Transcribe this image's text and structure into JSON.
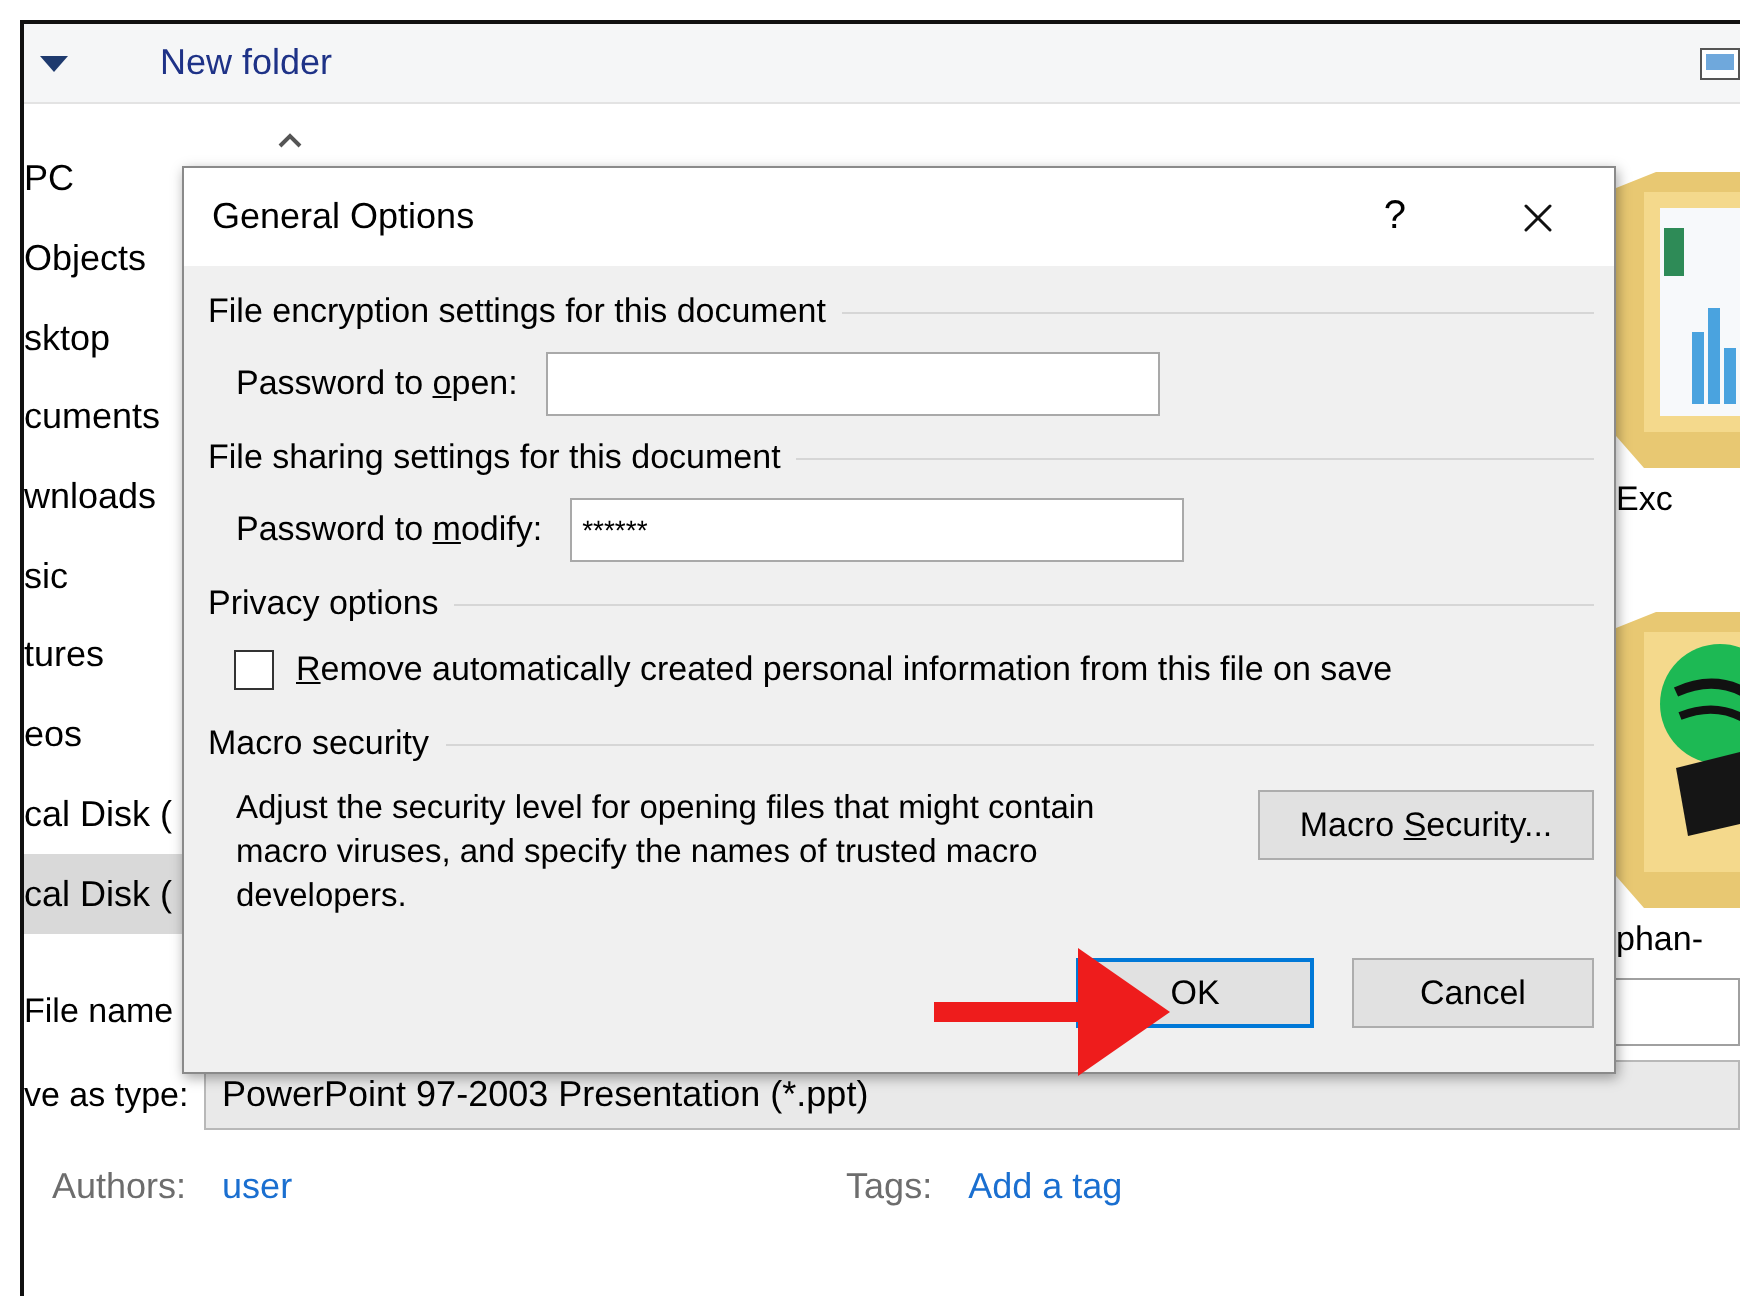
{
  "explorer": {
    "new_folder": "New folder",
    "nav_items": [
      {
        "label": "PC",
        "selected": false
      },
      {
        "label": "Objects",
        "selected": false
      },
      {
        "label": "sktop",
        "selected": false
      },
      {
        "label": "cuments",
        "selected": false
      },
      {
        "label": "wnloads",
        "selected": false
      },
      {
        "label": "sic",
        "selected": false
      },
      {
        "label": "tures",
        "selected": false
      },
      {
        "label": "eos",
        "selected": false
      },
      {
        "label": "cal Disk (",
        "selected": false
      },
      {
        "label": "cal Disk (",
        "selected": true
      }
    ],
    "files": [
      {
        "label": "Exc",
        "kind": "spreadsheet"
      },
      {
        "label": "phan-",
        "kind": "music"
      }
    ],
    "file_name": {
      "label": "File name"
    },
    "save_as_type": {
      "label": "ve as type:",
      "value": "PowerPoint 97-2003 Presentation (*.ppt)"
    },
    "authors": {
      "label": "Authors:",
      "value": "user"
    },
    "tags": {
      "label": "Tags:",
      "value": "Add a tag"
    }
  },
  "dialog": {
    "title": "General Options",
    "help": "?",
    "sections": [
      {
        "kind": "password",
        "heading": "File encryption settings for this document",
        "label": {
          "before": "Password to ",
          "key": "o",
          "after": "pen:"
        }
      },
      {
        "kind": "password",
        "heading": "File sharing settings for this document",
        "label": {
          "before": "Password to ",
          "key": "m",
          "after": "odify:"
        },
        "value": "******"
      },
      {
        "kind": "checkbox",
        "heading": "Privacy options",
        "label": {
          "key": "R",
          "after": "emove automatically created personal information from this file on save"
        },
        "checked": false
      },
      {
        "kind": "macro",
        "heading": "Macro security",
        "text": "Adjust the security level for opening files that might contain macro viruses, and specify the names of trusted macro developers.",
        "button": {
          "before": "Macro ",
          "key": "S",
          "after": "ecurity..."
        }
      }
    ],
    "buttons": [
      {
        "label": "OK",
        "default": true
      },
      {
        "label": "Cancel",
        "default": false
      }
    ]
  }
}
